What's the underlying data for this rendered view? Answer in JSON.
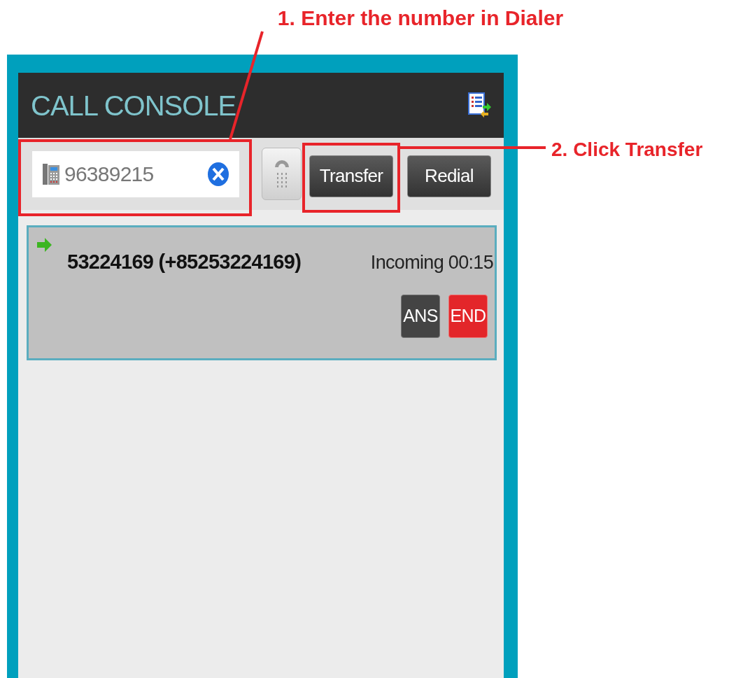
{
  "annotations": [
    {
      "text": "1. Enter the number in Dialer"
    },
    {
      "text": "2. Click Transfer"
    }
  ],
  "console": {
    "title": "CALL CONSOLE",
    "dialer": {
      "value": "96389215"
    },
    "buttons": [
      {
        "label": "Transfer",
        "highlighted": true
      },
      {
        "label": "Redial",
        "highlighted": false
      }
    ]
  },
  "calls": [
    {
      "number": "53224169 (+85253224169)",
      "status": "Incoming 00:15",
      "actions": [
        {
          "label": "ANS",
          "kind": "answer"
        },
        {
          "label": "END",
          "kind": "end"
        }
      ]
    }
  ]
}
